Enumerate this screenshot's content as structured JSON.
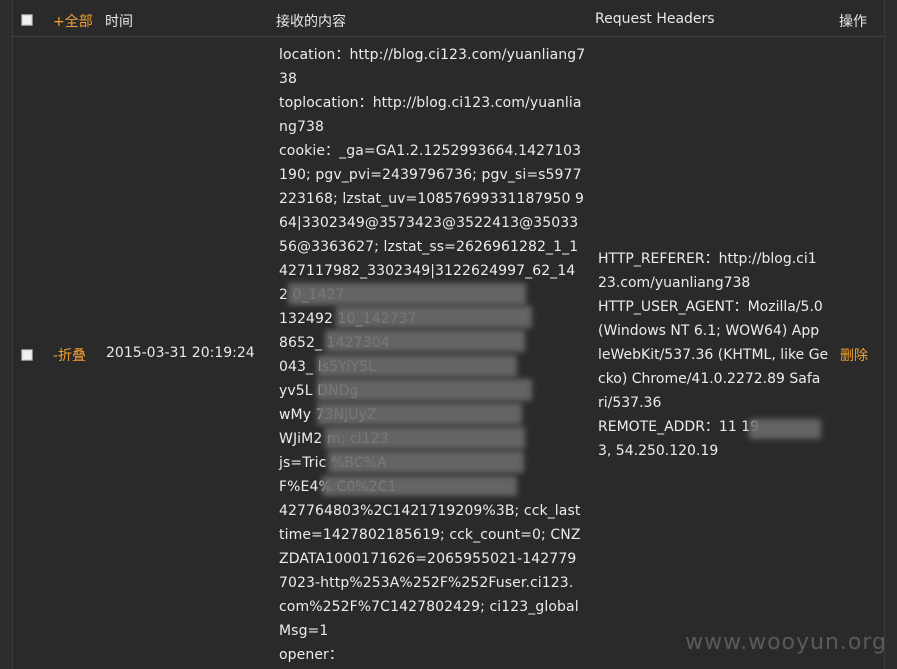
{
  "header": {
    "expand_all": "+全部",
    "time": "时间",
    "content": "接收的内容",
    "request_headers": "Request Headers",
    "action": "操作"
  },
  "row": {
    "collapse": "-折叠",
    "time": "2015-03-31 20:19:24",
    "delete": "删除",
    "content_lines": [
      "location：http://blog.ci123.com/yuanliang7",
      "38",
      "toplocation：http://blog.ci123.com/yuanlia",
      "ng738",
      "cookie：_ga=GA1.2.1252993664.1427103",
      "190; pgv_pvi=2439796736; pgv_si=s5977",
      "223168; lzstat_uv=10857699331187950 9",
      "64|3302349@3573423@3522413@35033",
      "56@3363627; lzstat_ss=2626961282_1_1",
      "427117982_3302349|3122624997_62_14",
      "2                        0_1427",
      "132492                      10_142737",
      "8652_                       1427304",
      "043_                        Is5YiY5L",
      "yv5L                          DNDg",
      "wMy                          73NjUyZ",
      "WJiM2                        m; ci123",
      "js=Tric                       %BC%A",
      "F%E4%                    C0%2C1",
      "427764803%2C1421719209%3B; cck_last",
      "time=1427802185619; cck_count=0; CNZ",
      "ZDATA1000171626=2065955021-142779",
      "7023-http%253A%252F%252Fuser.ci123.",
      "com%252F%7C1427802429; ci123_global",
      "Msg=1",
      "opener："
    ],
    "header_lines": [
      "HTTP_REFERER：http://blog.ci1",
      "23.com/yuanliang738",
      "HTTP_USER_AGENT：Mozilla/5.0",
      "(Windows NT 6.1; WOW64) App",
      "leWebKit/537.36 (KHTML, like Ge",
      "cko) Chrome/41.0.2272.89 Safa",
      "ri/537.36",
      "REMOTE_ADDR：11                19",
      "3, 54.250.120.19"
    ]
  },
  "watermark": "www.wooyun.org"
}
